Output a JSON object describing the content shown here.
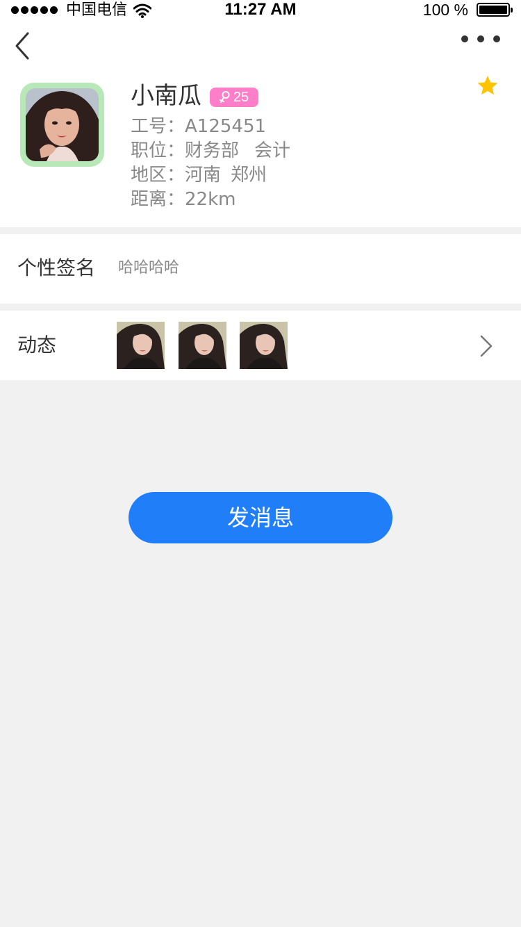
{
  "status_bar": {
    "carrier": "中国电信",
    "time": "11:27 AM",
    "battery": "100 %"
  },
  "profile": {
    "name": "小南瓜",
    "gender_symbol": "♀",
    "age": "25",
    "employee_id_label": "工号：",
    "employee_id": "A125451",
    "position_label": "职位：",
    "department": "财务部",
    "job": "会计",
    "region_label": "地区：",
    "province": "河南",
    "city": "郑州",
    "distance_label": "距离：",
    "distance": "22km"
  },
  "signature": {
    "label": "个性签名",
    "value": "哈哈哈哈"
  },
  "moments": {
    "label": "动态"
  },
  "actions": {
    "send_message": "发消息"
  },
  "colors": {
    "accent": "#1f7ef8",
    "badge": "#ff7ec9",
    "star": "#ffc300",
    "avatar_border": "#b8e8b8"
  },
  "icons": [
    "back-arrow-icon",
    "more-dots-icon",
    "star-icon",
    "female-icon",
    "chevron-right-icon",
    "wifi-icon",
    "battery-icon"
  ]
}
